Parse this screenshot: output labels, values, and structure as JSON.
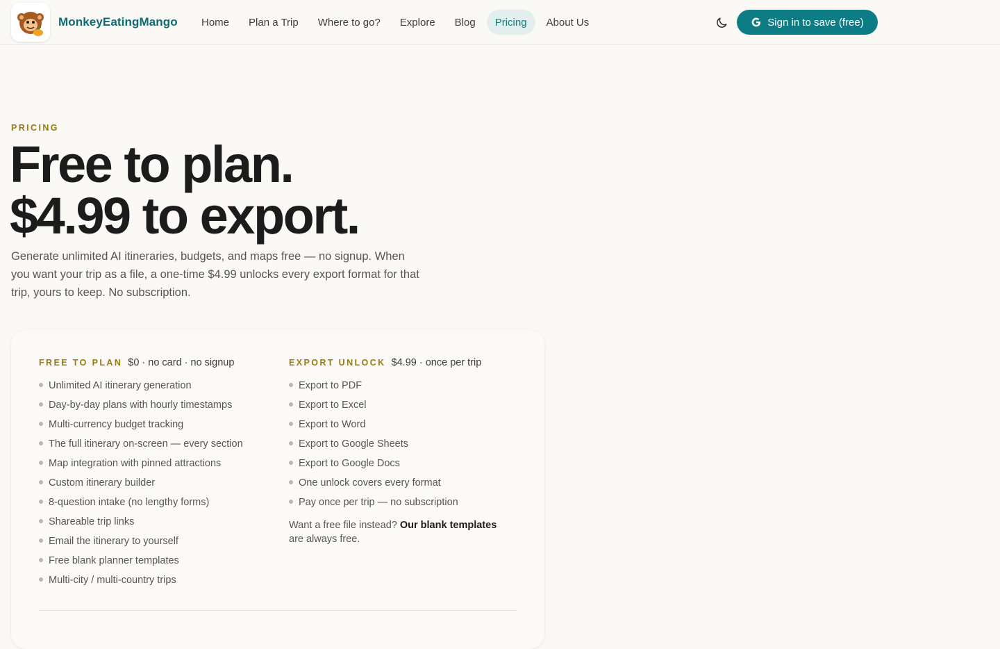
{
  "header": {
    "brand": "MonkeyEatingMango",
    "nav": [
      {
        "label": "Home",
        "active": false
      },
      {
        "label": "Plan a Trip",
        "active": false
      },
      {
        "label": "Where to go?",
        "active": false
      },
      {
        "label": "Explore",
        "active": false
      },
      {
        "label": "Blog",
        "active": false
      },
      {
        "label": "Pricing",
        "active": true
      },
      {
        "label": "About Us",
        "active": false
      }
    ],
    "theme_icon": "moon-icon",
    "signin_icon": "google-g-icon",
    "signin_label": "Sign in to save (free)",
    "accent": "#0e7c84"
  },
  "hero": {
    "eyebrow": "PRICING",
    "headline_line1": "Free to plan.",
    "headline_line2": "$4.99 to export.",
    "intro": "Generate unlimited AI itineraries, budgets, and maps free — no signup. When you want your trip as a file, a one-time $4.99 unlocks every export format for that trip, yours to keep. No subscription."
  },
  "plans": {
    "free": {
      "title": "FREE TO PLAN",
      "price": "$0 · no card · no signup",
      "features": [
        "Unlimited AI itinerary generation",
        "Day-by-day plans with hourly timestamps",
        "Multi-currency budget tracking",
        "The full itinerary on-screen — every section",
        "Map integration with pinned attractions",
        "Custom itinerary builder",
        "8-question intake (no lengthy forms)",
        "Shareable trip links",
        "Email the itinerary to yourself",
        "Free blank planner templates",
        "Multi-city / multi-country trips"
      ]
    },
    "export": {
      "title": "EXPORT UNLOCK",
      "price": "$4.99 · once per trip",
      "features": [
        "Export to PDF",
        "Export to Excel",
        "Export to Word",
        "Export to Google Sheets",
        "Export to Google Docs",
        "One unlock covers every format",
        "Pay once per trip — no subscription"
      ],
      "note_prefix": "Want a free file instead? ",
      "note_link": "Our blank templates",
      "note_suffix": " are always free."
    }
  }
}
